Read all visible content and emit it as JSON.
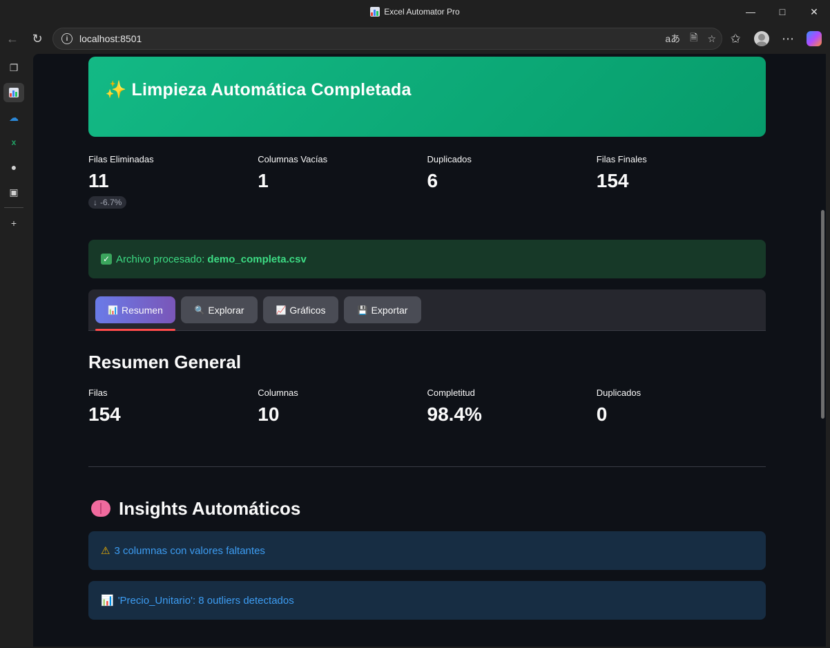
{
  "window": {
    "title": "Excel Automator Pro"
  },
  "browser": {
    "url": "localhost:8501",
    "read_aloud": "aあ"
  },
  "banner": {
    "emoji": "✨",
    "title": "Limpieza Automática Completada"
  },
  "cleaning_metrics": [
    {
      "label": "Filas Eliminadas",
      "value": "11",
      "delta": "-6.7%"
    },
    {
      "label": "Columnas Vacías",
      "value": "1"
    },
    {
      "label": "Duplicados",
      "value": "6"
    },
    {
      "label": "Filas Finales",
      "value": "154"
    }
  ],
  "success": {
    "prefix": "Archivo procesado:",
    "filename": "demo_completa.csv"
  },
  "tabs": [
    {
      "icon": "📊",
      "label": "Resumen",
      "active": true
    },
    {
      "icon": "🔍",
      "label": "Explorar"
    },
    {
      "icon": "📈",
      "label": "Gráficos"
    },
    {
      "icon": "💾",
      "label": "Exportar"
    }
  ],
  "summary": {
    "title": "Resumen General",
    "metrics": [
      {
        "label": "Filas",
        "value": "154"
      },
      {
        "label": "Columnas",
        "value": "10"
      },
      {
        "label": "Completitud",
        "value": "98.4%"
      },
      {
        "label": "Duplicados",
        "value": "0"
      }
    ]
  },
  "insights": {
    "title": "Insights Automáticos",
    "items": [
      {
        "icon": "⚠",
        "text": "3 columnas con valores faltantes"
      },
      {
        "icon": "📊",
        "text": "'Precio_Unitario': 8 outliers detectados"
      }
    ]
  },
  "colors": {
    "banner": "#13b985",
    "success_text": "#3ddc84",
    "info_text": "#3d9df3",
    "tab_underline": "#ff4b4b"
  }
}
